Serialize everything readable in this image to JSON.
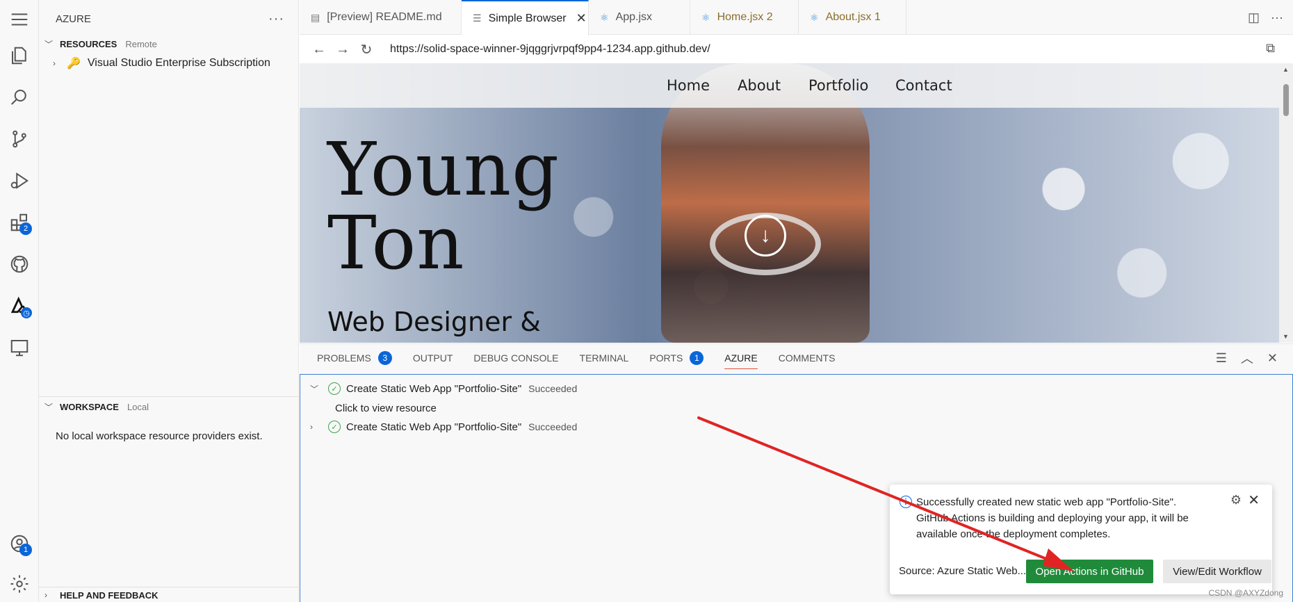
{
  "activity_bar": {
    "icons": [
      "menu-icon",
      "explorer-icon",
      "search-icon",
      "source-control-icon",
      "run-debug-icon",
      "extensions-icon",
      "github-icon",
      "azure-icon",
      "remote-explorer-icon",
      "account-icon",
      "settings-icon"
    ],
    "extensions_badge": "2",
    "account_badge": "1"
  },
  "sidebar": {
    "title": "AZURE",
    "more": "···",
    "resources": {
      "title": "RESOURCES",
      "sub": "Remote",
      "item": "Visual Studio Enterprise Subscription"
    },
    "workspace": {
      "title": "WORKSPACE",
      "sub": "Local",
      "empty": "No local workspace resource providers exist."
    },
    "help": {
      "title": "HELP AND FEEDBACK"
    }
  },
  "tabs": [
    {
      "label": "[Preview] README.md",
      "icon": "preview-icon"
    },
    {
      "label": "Simple Browser",
      "icon": "browser-icon"
    },
    {
      "label": "App.jsx",
      "icon": "react-icon"
    },
    {
      "label": "Home.jsx 2",
      "icon": "react-icon"
    },
    {
      "label": "About.jsx 1",
      "icon": "react-icon"
    }
  ],
  "browser": {
    "url": "https://solid-space-winner-9jqggrjvrpqf9pp4-1234.app.github.dev/",
    "nav": [
      "Home",
      "About",
      "Portfolio",
      "Contact"
    ],
    "hero_line1": "Young",
    "hero_line2": "Ton",
    "hero_sub": "Web Designer &"
  },
  "panel": {
    "tabs": [
      "PROBLEMS",
      "OUTPUT",
      "DEBUG CONSOLE",
      "TERMINAL",
      "PORTS",
      "AZURE",
      "COMMENTS"
    ],
    "problems_badge": "3",
    "ports_badge": "1",
    "rows": [
      {
        "text": "Create Static Web App \"Portfolio-Site\"",
        "status": "Succeeded"
      },
      {
        "text": "Click to view resource"
      },
      {
        "text": "Create Static Web App \"Portfolio-Site\"",
        "status": "Succeeded"
      }
    ]
  },
  "notification": {
    "message": "Successfully created new static web app \"Portfolio-Site\". GitHub Actions is building and deploying your app, it will be available once the deployment completes.",
    "source": "Source: Azure Static Web...",
    "primary": "Open Actions in GitHub",
    "secondary": "View/Edit Workflow"
  },
  "colors": {
    "accent": "#0a66d8",
    "primary_button": "#1f8b3a",
    "annotation_arrow": "#e02424",
    "success": "#3fa34d"
  },
  "watermark": "CSDN @AXYZdong"
}
